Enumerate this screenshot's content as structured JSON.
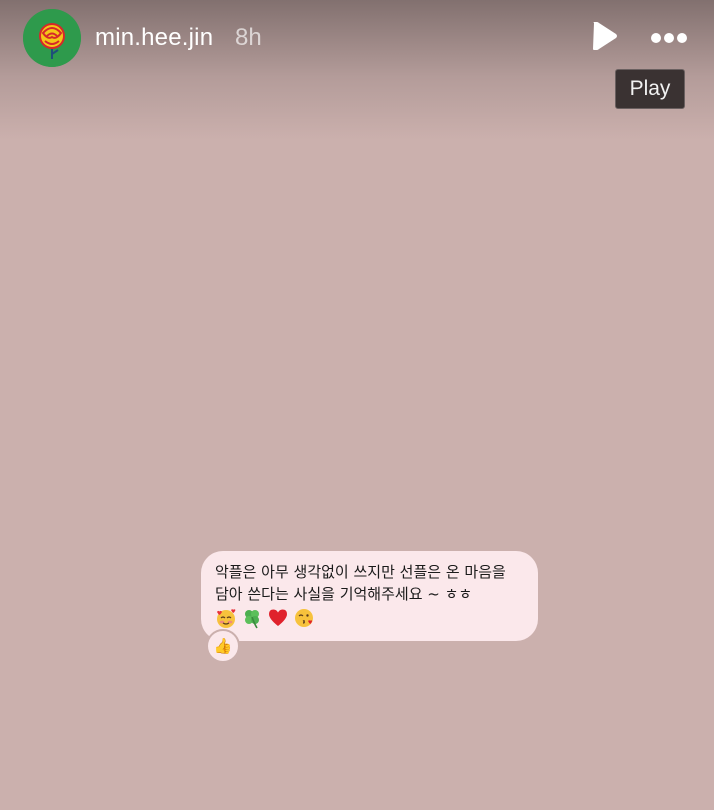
{
  "story": {
    "background_color": "#cbb0ad"
  },
  "header": {
    "username": "min.hee.jin",
    "timestamp": "8h",
    "play_tooltip": "Play"
  },
  "message": {
    "line1": "악플은 아무 생각없이 쓰지만 선플은 온 마음을",
    "line2": "담아 쓴다는 사실을 기억해주세요 ~ ㅎㅎ",
    "emojis": [
      "smiling-face-with-hearts",
      "four-leaf-clover",
      "red-heart",
      "face-blowing-kiss"
    ],
    "reaction": "👍"
  },
  "colors": {
    "avatar_bg": "#2e9a4c",
    "bubble_bg": "#fbe8eb",
    "tooltip_bg": "#3a3232"
  }
}
